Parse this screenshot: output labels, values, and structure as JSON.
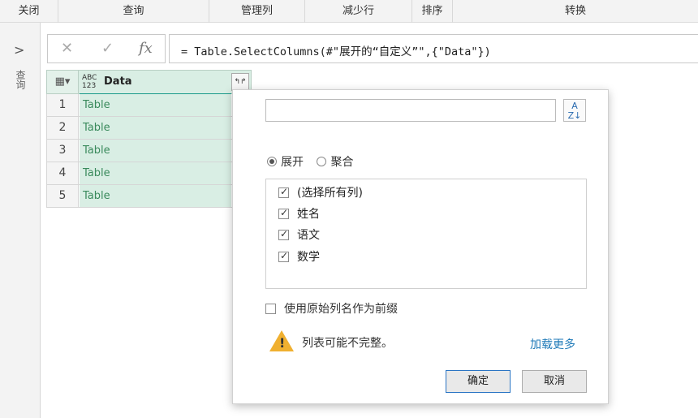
{
  "ribbon": {
    "groups": [
      "关闭",
      "查询",
      "管理列",
      "减少行",
      "排序",
      "转换"
    ]
  },
  "query_pane": {
    "expand_icon": "chevron-right-icon",
    "label": "查询"
  },
  "formula": {
    "cancel_icon": "✕",
    "commit_icon": "✓",
    "fx_label": "fx",
    "text": "= Table.SelectColumns(#\"展开的“自定义”\",{\"Data\"})"
  },
  "grid": {
    "type_badge": "ABC\n123",
    "column": "Data",
    "rows": [
      {
        "num": "1",
        "val": "Table"
      },
      {
        "num": "2",
        "val": "Table"
      },
      {
        "num": "3",
        "val": "Table"
      },
      {
        "num": "4",
        "val": "Table"
      },
      {
        "num": "5",
        "val": "Table"
      }
    ]
  },
  "popup": {
    "search_placeholder": "",
    "sort_label": "A↓Z",
    "radio_expand": "展开",
    "radio_aggregate": "聚合",
    "columns": [
      "(选择所有列)",
      "姓名",
      "语文",
      "数学"
    ],
    "prefix_label": "使用原始列名作为前缀",
    "warning": "列表可能不完整。",
    "load_more": "加载更多",
    "ok": "确定",
    "cancel": "取消"
  }
}
